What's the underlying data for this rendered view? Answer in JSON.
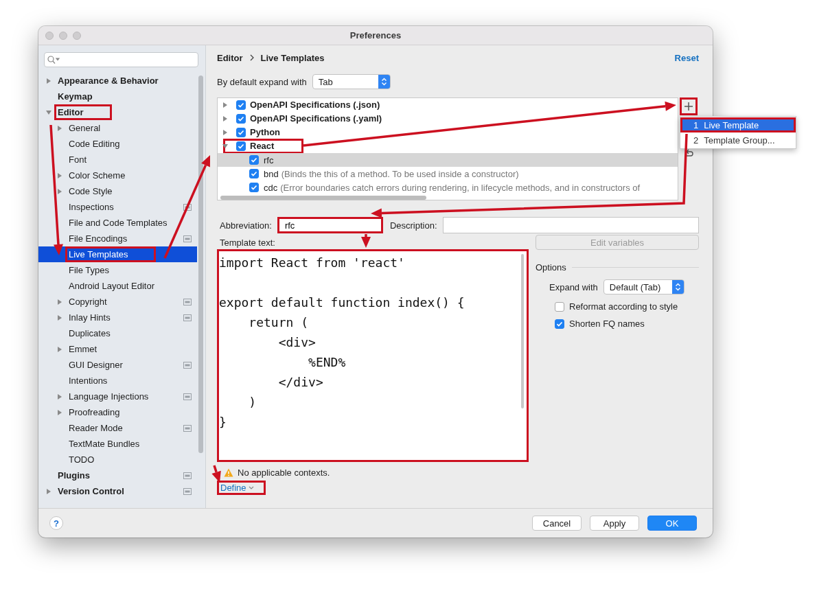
{
  "window": {
    "title": "Preferences"
  },
  "sidebar": {
    "items": [
      {
        "label": "Appearance & Behavior",
        "expanded": false,
        "selected": false,
        "project_scope": false,
        "annotated": false
      },
      {
        "label": "Keymap",
        "selected": false,
        "project_scope": false,
        "annotated": false
      },
      {
        "label": "Editor",
        "expanded": true,
        "selected": false,
        "project_scope": false,
        "annotated": true,
        "children": [
          {
            "label": "General",
            "expanded": false,
            "selected": false,
            "project_scope": false,
            "annotated": false
          },
          {
            "label": "Code Editing",
            "selected": false,
            "project_scope": false,
            "annotated": false
          },
          {
            "label": "Font",
            "selected": false,
            "project_scope": false,
            "annotated": false
          },
          {
            "label": "Color Scheme",
            "expanded": false,
            "selected": false,
            "project_scope": false,
            "annotated": false
          },
          {
            "label": "Code Style",
            "expanded": false,
            "selected": false,
            "project_scope": false,
            "annotated": false
          },
          {
            "label": "Inspections",
            "selected": false,
            "project_scope": true,
            "annotated": false
          },
          {
            "label": "File and Code Templates",
            "selected": false,
            "project_scope": false,
            "annotated": false
          },
          {
            "label": "File Encodings",
            "selected": false,
            "project_scope": true,
            "annotated": false
          },
          {
            "label": "Live Templates",
            "selected": true,
            "project_scope": false,
            "annotated": true
          },
          {
            "label": "File Types",
            "selected": false,
            "project_scope": false,
            "annotated": false
          },
          {
            "label": "Android Layout Editor",
            "selected": false,
            "project_scope": false,
            "annotated": false
          },
          {
            "label": "Copyright",
            "expanded": false,
            "selected": false,
            "project_scope": true,
            "annotated": false
          },
          {
            "label": "Inlay Hints",
            "expanded": false,
            "selected": false,
            "project_scope": true,
            "annotated": false
          },
          {
            "label": "Duplicates",
            "selected": false,
            "project_scope": false,
            "annotated": false
          },
          {
            "label": "Emmet",
            "expanded": false,
            "selected": false,
            "project_scope": false,
            "annotated": false
          },
          {
            "label": "GUI Designer",
            "selected": false,
            "project_scope": true,
            "annotated": false
          },
          {
            "label": "Intentions",
            "selected": false,
            "project_scope": false,
            "annotated": false
          },
          {
            "label": "Language Injections",
            "expanded": false,
            "selected": false,
            "project_scope": true,
            "annotated": false
          },
          {
            "label": "Proofreading",
            "expanded": false,
            "selected": false,
            "project_scope": false,
            "annotated": false
          },
          {
            "label": "Reader Mode",
            "selected": false,
            "project_scope": true,
            "annotated": false
          },
          {
            "label": "TextMate Bundles",
            "selected": false,
            "project_scope": false,
            "annotated": false
          },
          {
            "label": "TODO",
            "selected": false,
            "project_scope": false,
            "annotated": false
          }
        ]
      },
      {
        "label": "Plugins",
        "selected": false,
        "project_scope": true,
        "annotated": false
      },
      {
        "label": "Version Control",
        "expanded": false,
        "selected": false,
        "project_scope": true,
        "annotated": false
      }
    ]
  },
  "header": {
    "breadcrumb": [
      "Editor",
      "Live Templates"
    ],
    "reset": "Reset"
  },
  "expand_default": {
    "label": "By default expand with",
    "value": "Tab"
  },
  "template_groups": [
    {
      "label": "OpenAPI Specifications (.json)",
      "checked": true,
      "expanded": false,
      "annotated": false
    },
    {
      "label": "OpenAPI Specifications (.yaml)",
      "checked": true,
      "expanded": false,
      "annotated": false
    },
    {
      "label": "Python",
      "checked": true,
      "expanded": false,
      "annotated": false
    },
    {
      "label": "React",
      "checked": true,
      "expanded": true,
      "annotated": true,
      "children": [
        {
          "abbreviation": "rfc",
          "checked": true,
          "selected": true
        },
        {
          "abbreviation": "bnd",
          "description": "(Binds the this of a method. To be used inside a constructor)",
          "checked": true,
          "selected": false
        },
        {
          "abbreviation": "cdc",
          "description": "(Error boundaries catch errors during rendering, in lifecycle methods, and in constructors of",
          "checked": true,
          "selected": false
        }
      ]
    }
  ],
  "add_button": {
    "annotated": true
  },
  "add_menu": [
    {
      "number": "1",
      "label": "Live Template",
      "selected": true,
      "annotated": true
    },
    {
      "number": "2",
      "label": "Template Group...",
      "selected": false,
      "annotated": false
    }
  ],
  "abbreviation": {
    "label": "Abbreviation:",
    "value": "rfc",
    "annotated": true
  },
  "description": {
    "label": "Description:"
  },
  "template_text": {
    "label": "Template text:",
    "text": "import React from 'react'\n\nexport default function index() {\n    return (\n        <div>\n            %END%\n        </div>\n    )\n}",
    "annotated": true
  },
  "edit_variables": {
    "label": "Edit variables",
    "disabled": true
  },
  "options": {
    "title": "Options",
    "expand_with": {
      "label": "Expand with",
      "value": "Default (Tab)"
    },
    "checkboxes": [
      {
        "label": "Reformat according to style",
        "checked": false
      },
      {
        "label": "Shorten FQ names",
        "checked": true
      }
    ]
  },
  "warning": "No applicable contexts.",
  "define": {
    "label": "Define",
    "annotated": true
  },
  "help": "?",
  "buttons": [
    {
      "label": "Cancel",
      "primary": false
    },
    {
      "label": "Apply",
      "primary": false
    },
    {
      "label": "OK",
      "primary": true
    }
  ]
}
